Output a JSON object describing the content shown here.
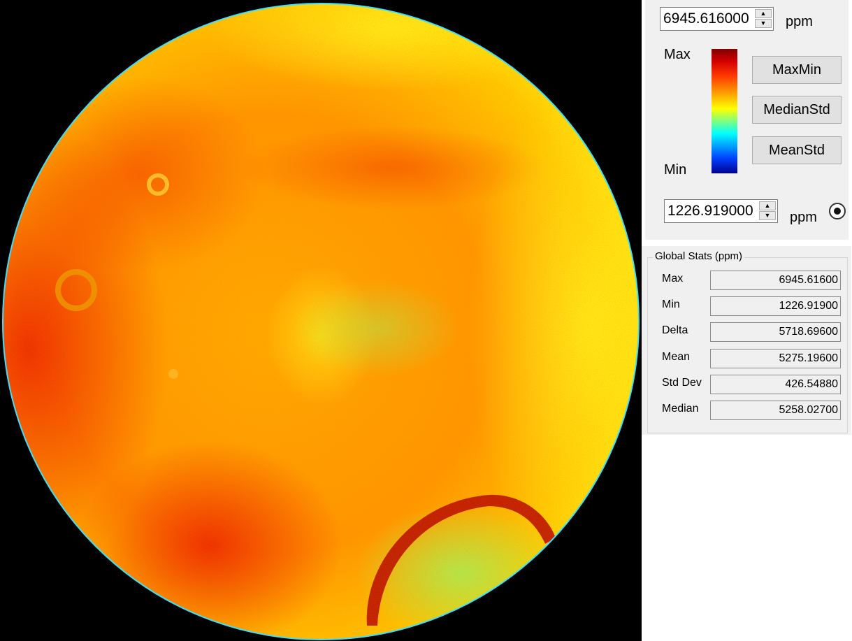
{
  "colors": {
    "viewer_background": "#000000",
    "panel_background": "#f0f0f0",
    "map_dominant": "#ff8c00",
    "map_edge": "#ffff00"
  },
  "scale": {
    "max_value": "6945.616000",
    "min_value": "1226.919000",
    "unit": "ppm",
    "max_label": "Max",
    "min_label": "Min",
    "colorbar_name": "jet-colormap"
  },
  "buttons": {
    "maxmin": "MaxMin",
    "medianstd": "MedianStd",
    "meanstd": "MeanStd"
  },
  "global_stats": {
    "title": "Global Stats (ppm)",
    "rows": [
      {
        "label": "Max",
        "value": "6945.61600"
      },
      {
        "label": "Min",
        "value": "1226.91900"
      },
      {
        "label": "Delta",
        "value": "5718.69600"
      },
      {
        "label": "Mean",
        "value": "5275.19600"
      },
      {
        "label": "Std Dev",
        "value": "426.54880"
      },
      {
        "label": "Median",
        "value": "5258.02700"
      }
    ]
  }
}
